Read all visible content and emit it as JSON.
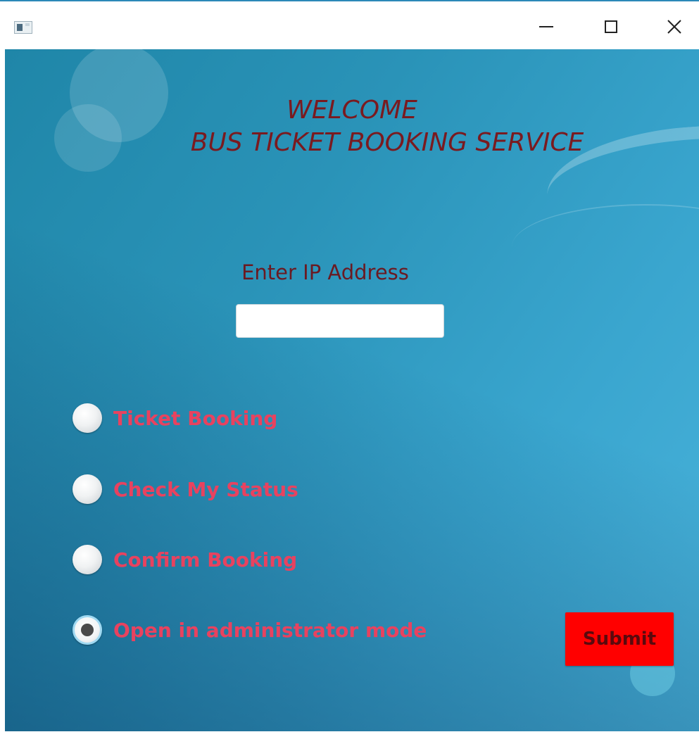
{
  "window": {
    "icon": "app-window-icon",
    "controls": {
      "minimize_icon": "minimize-icon",
      "maximize_icon": "maximize-icon",
      "close_icon": "close-icon"
    }
  },
  "header": {
    "line1": "WELCOME",
    "line2": "BUS TICKET BOOKING SERVICE"
  },
  "ip": {
    "label": "Enter IP Address",
    "value": "",
    "placeholder": ""
  },
  "options": [
    {
      "label": "Ticket Booking",
      "selected": false
    },
    {
      "label": "Check My Status",
      "selected": false
    },
    {
      "label": "Confirm Booking",
      "selected": false
    },
    {
      "label": "Open in administrator mode",
      "selected": true
    }
  ],
  "submit": {
    "label": "Submit"
  },
  "colors": {
    "title": "#7a1a1f",
    "option_label": "#e8425f",
    "submit_bg": "#ff0000",
    "submit_text": "#5a0a0e"
  }
}
